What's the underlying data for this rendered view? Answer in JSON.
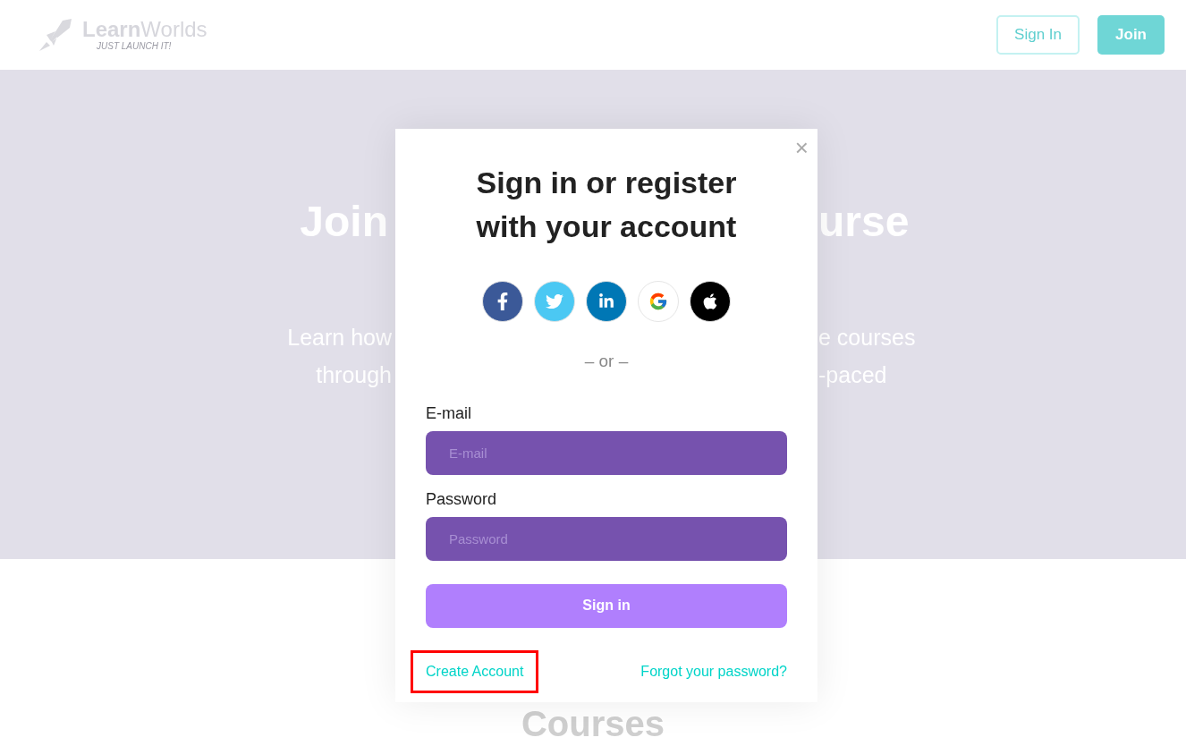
{
  "header": {
    "logo": {
      "name": "**Learn**Worlds",
      "tagline": "JUST LAUNCH IT!"
    },
    "buttons": [
      {
        "label": "Sign In",
        "kind": "outline"
      },
      {
        "label": "Join",
        "kind": "filled"
      }
    ]
  },
  "hero": {
    "title_left": "Join",
    "title_right": "urse",
    "subtitle_left": [
      "Learn how",
      "through"
    ],
    "subtitle_right": [
      "e courses",
      "-paced"
    ]
  },
  "below_heading": "Courses",
  "modal": {
    "close": "×",
    "title": "Sign in or register with your account",
    "social": [
      {
        "kind": "facebook",
        "color": "#3b5998"
      },
      {
        "kind": "twitter",
        "color": "#4bc8f3"
      },
      {
        "kind": "linkedin",
        "color": "#0077b5"
      },
      {
        "kind": "google",
        "color": "#ffffff"
      },
      {
        "kind": "apple",
        "color": "#000000"
      }
    ],
    "divider": "– or –",
    "fields": [
      {
        "label": "E-mail",
        "placeholder": "E-mail"
      },
      {
        "label": "Password",
        "placeholder": "Password"
      }
    ],
    "submit": "Sign in",
    "links": [
      {
        "label": "Create Account",
        "highlighted": true
      },
      {
        "label": "Forgot your password?",
        "highlighted": false
      }
    ]
  }
}
